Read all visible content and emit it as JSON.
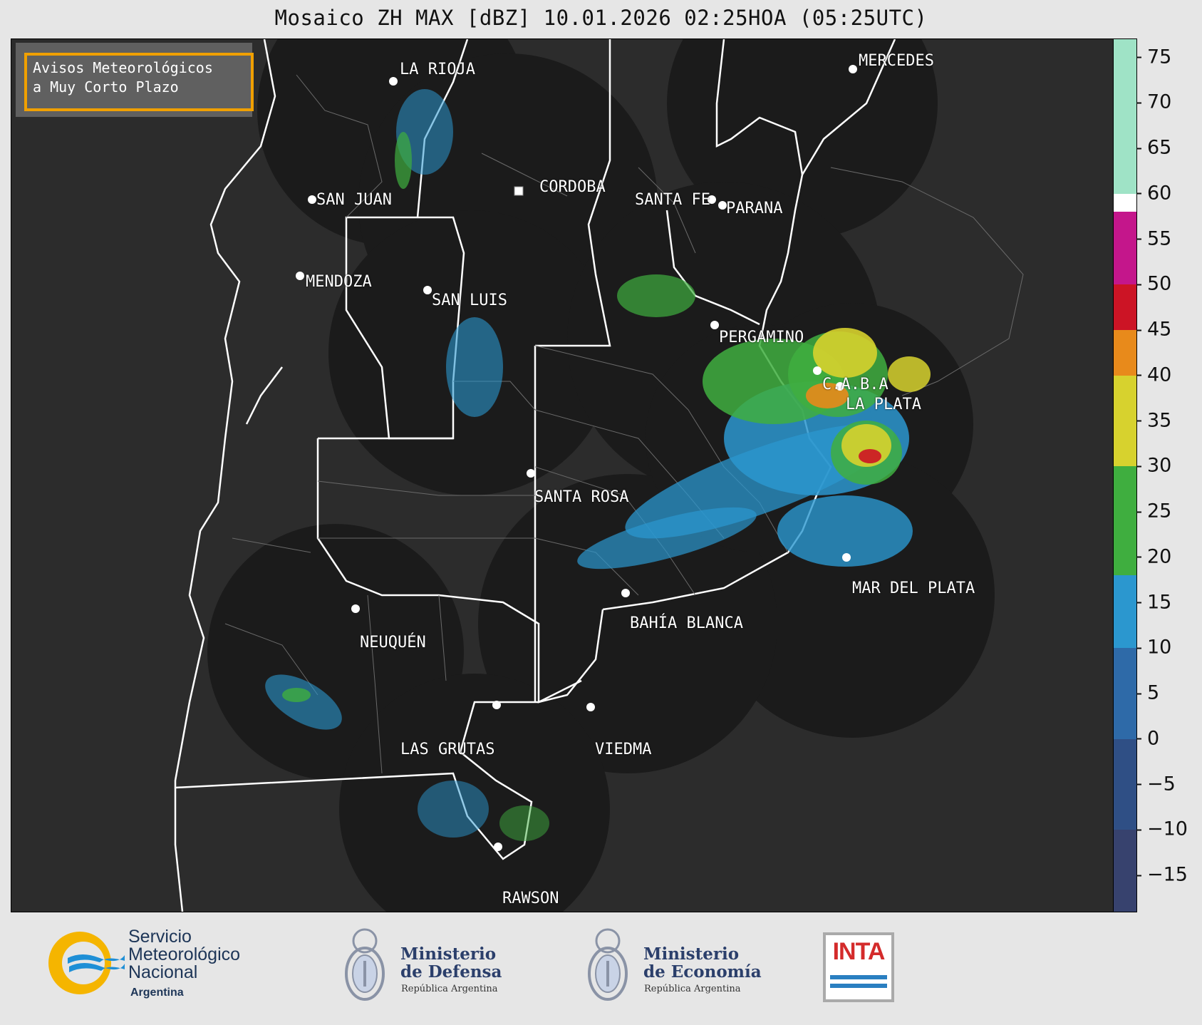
{
  "title": "Mosaico ZH MAX [dBZ] 10.01.2026 02:25HOA (05:25UTC)",
  "notice": {
    "line1": "Avisos Meteorológicos",
    "line2": "a Muy Corto Plazo",
    "border_color": "#f0a000"
  },
  "cities": [
    {
      "name": "LA RIOJA"
    },
    {
      "name": "SAN JUAN"
    },
    {
      "name": "CORDOBA"
    },
    {
      "name": "SANTA FE"
    },
    {
      "name": "PARANA"
    },
    {
      "name": "MENDOZA"
    },
    {
      "name": "SAN LUIS"
    },
    {
      "name": "PERGAMINO"
    },
    {
      "name": "C.A.B.A"
    },
    {
      "name": "LA PLATA"
    },
    {
      "name": "SANTA ROSA"
    },
    {
      "name": "MAR DEL PLATA"
    },
    {
      "name": "BAHÍA BLANCA"
    },
    {
      "name": "NEUQUÉN"
    },
    {
      "name": "LAS GRUTAS"
    },
    {
      "name": "VIEDMA"
    },
    {
      "name": "RAWSON"
    },
    {
      "name": "MERCEDES"
    }
  ],
  "colorbar": {
    "unit": "dBZ",
    "range": [
      -19,
      77
    ],
    "ticks": [
      "75",
      "70",
      "65",
      "60",
      "55",
      "50",
      "45",
      "40",
      "35",
      "30",
      "25",
      "20",
      "15",
      "10",
      "5",
      "0",
      "−5",
      "−10",
      "−15"
    ],
    "tick_values": [
      75,
      70,
      65,
      60,
      55,
      50,
      45,
      40,
      35,
      30,
      25,
      20,
      15,
      10,
      5,
      0,
      -5,
      -10,
      -15
    ],
    "bands": [
      {
        "from": -19,
        "to": -10,
        "color": "#37426e"
      },
      {
        "from": -10,
        "to": 0,
        "color": "#2f4f85"
      },
      {
        "from": 0,
        "to": 10,
        "color": "#2e6aa8"
      },
      {
        "from": 10,
        "to": 18,
        "color": "#2b97cf"
      },
      {
        "from": 18,
        "to": 30,
        "color": "#3fae3f"
      },
      {
        "from": 30,
        "to": 40,
        "color": "#d7d22e"
      },
      {
        "from": 40,
        "to": 45,
        "color": "#e88a1b"
      },
      {
        "from": 45,
        "to": 50,
        "color": "#cc1425"
      },
      {
        "from": 50,
        "to": 58,
        "color": "#c4168b"
      },
      {
        "from": 58,
        "to": 60,
        "color": "#ffffff"
      },
      {
        "from": 60,
        "to": 77,
        "color": "#9fe3c6"
      }
    ]
  },
  "footer": {
    "smn_line1": "Servicio",
    "smn_line2": "Meteorológico",
    "smn_line3": "Nacional",
    "smn_country": "Argentina",
    "defensa_line1": "Ministerio",
    "defensa_line2": "de Defensa",
    "defensa_sub": "República Argentina",
    "economia_line1": "Ministerio",
    "economia_line2": "de Economía",
    "economia_sub": "República Argentina",
    "inta": "INTA"
  }
}
